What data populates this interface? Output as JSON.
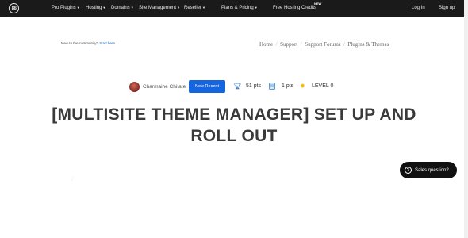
{
  "nav": {
    "logo_text": "88",
    "items": [
      "Pro Plugins",
      "Hosting",
      "Domains",
      "Site Management",
      "Reseller",
      "Plans & Pricing",
      "Free Hosting Credits"
    ],
    "new_badge": "NEW",
    "login": "Log In",
    "signup": "Sign up"
  },
  "community": {
    "prefix": "New to the community?",
    "link": "Start here"
  },
  "breadcrumb": [
    "Home",
    "Support",
    "Support Forums",
    "Plugins & Themes"
  ],
  "meta": {
    "author": "Charmaine Chitate",
    "recent_button": "New Recent",
    "points": "51 pts",
    "second_points": "1 pts",
    "level": "LEVEL 0"
  },
  "title": "[MULTISITE THEME MANAGER] SET UP AND ROLL OUT",
  "chat": {
    "label": "Sales question?"
  },
  "colors": {
    "topbar": "#1a1a1a",
    "accent": "#1565e0",
    "trophy": "#1a5fbf",
    "star": "#f2b705"
  },
  "icons": [
    "logo-icon",
    "trophy-icon",
    "document-icon",
    "star-icon",
    "question-icon",
    "avatar"
  ]
}
